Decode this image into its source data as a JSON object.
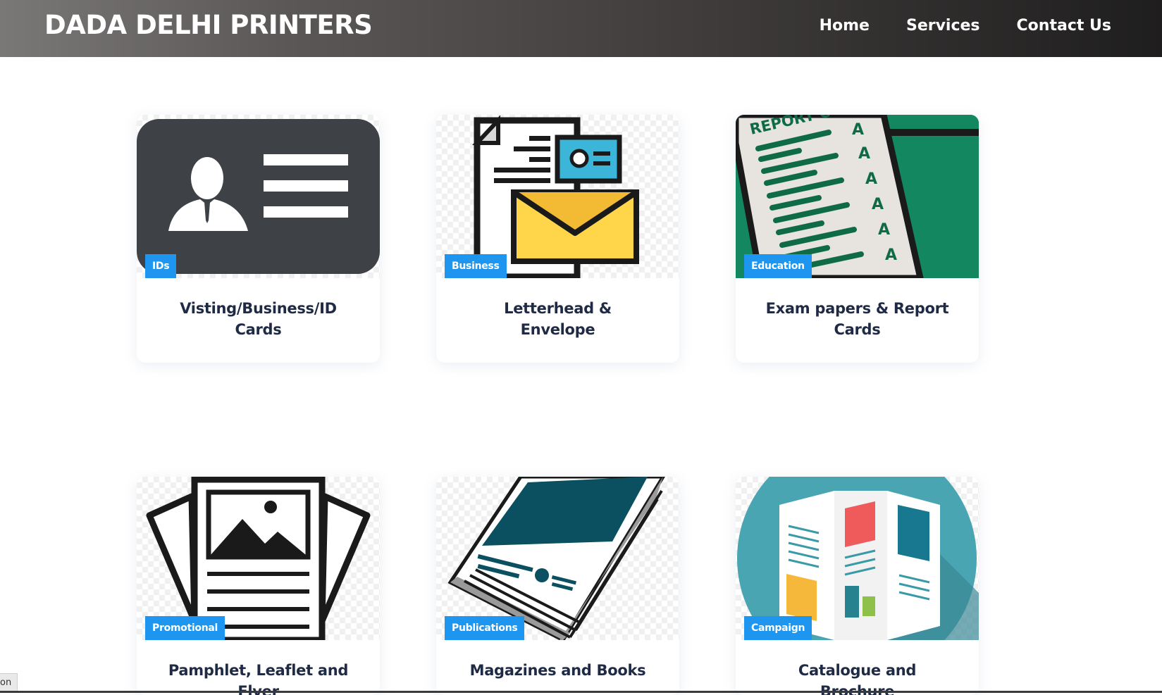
{
  "brand": "DADA DELHI PRINTERS",
  "nav": [
    "Home",
    "Services",
    "Contact Us"
  ],
  "cards": [
    {
      "badge": "IDs",
      "title": "Visting/Business/ID Cards"
    },
    {
      "badge": "Business",
      "title": "Letterhead & Envelope"
    },
    {
      "badge": "Education",
      "title": "Exam papers & Report Cards"
    },
    {
      "badge": "Promotional",
      "title": "Pamphlet, Leaflet and Flyer"
    },
    {
      "badge": "Publications",
      "title": "Magazines and Books"
    },
    {
      "badge": "Campaign",
      "title": "Catalogue and Brochure"
    }
  ],
  "status_tip": "on",
  "colors": {
    "badge": "#1e96ef",
    "title": "#1f2a44",
    "navbar_end": "#1f1e1e"
  }
}
